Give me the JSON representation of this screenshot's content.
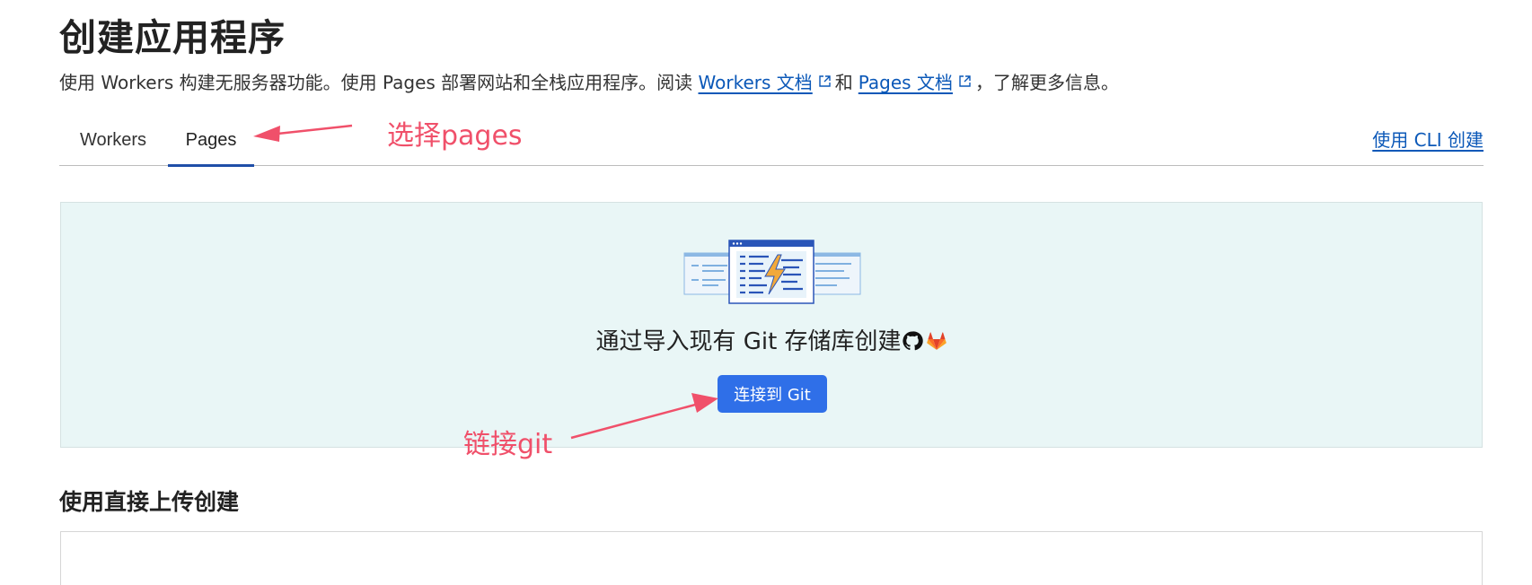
{
  "page": {
    "title": "创建应用程序",
    "description": {
      "prefix": "使用 Workers 构建无服务器功能。使用 Pages 部署网站和全栈应用程序。阅读 ",
      "workers_docs_link": "Workers 文档",
      "conjunction": "和",
      "pages_docs_link": "Pages 文档",
      "suffix": "，了解更多信息。"
    }
  },
  "tabs": [
    {
      "label": "Workers",
      "active": false
    },
    {
      "label": "Pages",
      "active": true
    }
  ],
  "cli_link": "使用 CLI 创建",
  "git_import": {
    "text": "通过导入现有 Git 存储库创建",
    "icons": [
      "github-icon",
      "gitlab-icon"
    ],
    "button_label": "连接到 Git"
  },
  "direct_upload": {
    "title": "使用直接上传创建"
  },
  "annotations": {
    "select_pages": "选择pages",
    "link_git": "链接git"
  },
  "colors": {
    "link": "#0b58b8",
    "primary_button": "#2f6fe8",
    "panel_bg": "#e9f6f6",
    "active_tab": "#1f4ea8",
    "annotation": "#f0506a"
  }
}
